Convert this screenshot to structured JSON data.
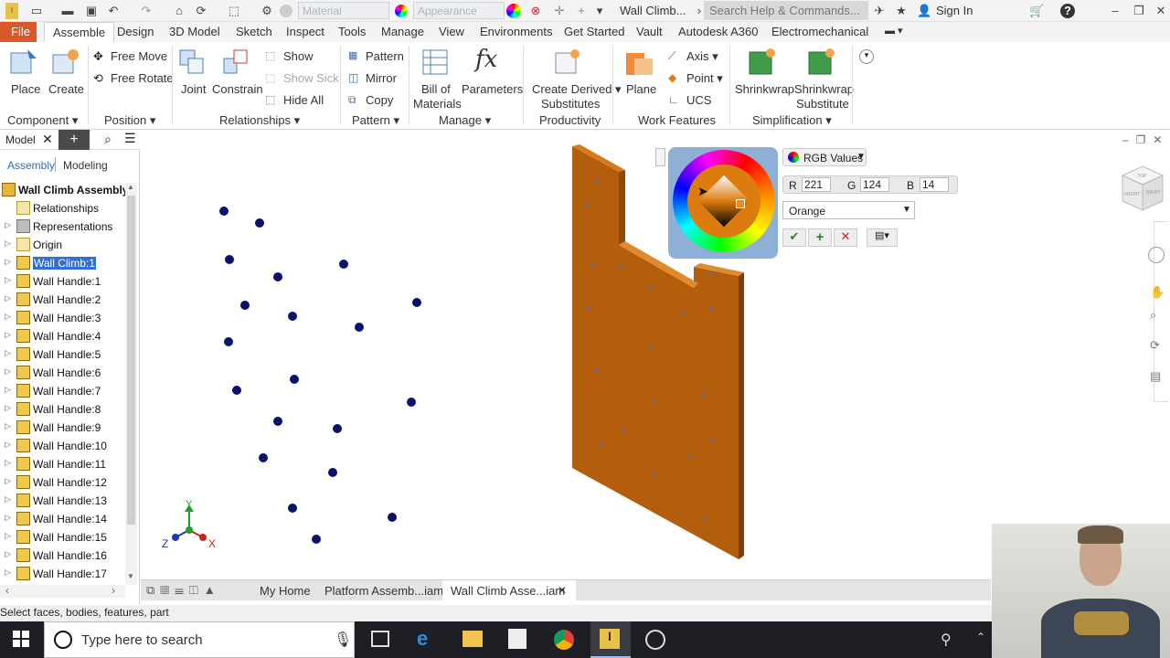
{
  "titlebar": {
    "material_placeholder": "Material",
    "appearance_placeholder": "Appearance",
    "document_title": "Wall Climb...",
    "help_search_placeholder": "Search Help & Commands...",
    "sign_in": "Sign In"
  },
  "tabs": [
    "File",
    "Assemble",
    "Design",
    "3D Model",
    "Sketch",
    "Inspect",
    "Tools",
    "Manage",
    "View",
    "Environments",
    "Get Started",
    "Vault",
    "Autodesk A360",
    "Electromechanical"
  ],
  "ribbon": {
    "place": "Place",
    "create": "Create",
    "free_move": "Free Move",
    "free_rotate": "Free Rotate",
    "joint": "Joint",
    "constrain": "Constrain",
    "show": "Show",
    "show_sick": "Show Sick",
    "hide_all": "Hide All",
    "pattern": "Pattern",
    "mirror": "Mirror",
    "copy": "Copy",
    "bill_of_materials_1": "Bill of",
    "bill_of_materials_2": "Materials",
    "parameters": "Parameters",
    "create_derived_1": "Create Derived",
    "create_derived_2": "Substitutes",
    "plane": "Plane",
    "axis": "Axis",
    "point": "Point",
    "ucs": "UCS",
    "shrinkwrap": "Shrinkwrap",
    "shrinkwrap_sub_1": "Shrinkwrap",
    "shrinkwrap_sub_2": "Substitute",
    "groups": {
      "component": "Component",
      "position": "Position",
      "relationships": "Relationships",
      "pattern": "Pattern",
      "manage": "Manage",
      "productivity": "Productivity",
      "work_features": "Work Features",
      "simplification": "Simplification"
    }
  },
  "browser": {
    "title": "Model",
    "tab_assembly": "Assembly",
    "tab_modeling": "Modeling",
    "root": "Wall Climb Assembly",
    "items": [
      "Relationships",
      "Representations",
      "Origin",
      "Wall Climb:1",
      "Wall Handle:1",
      "Wall Handle:2",
      "Wall Handle:3",
      "Wall Handle:4",
      "Wall Handle:5",
      "Wall Handle:6",
      "Wall Handle:7",
      "Wall Handle:8",
      "Wall Handle:9",
      "Wall Handle:10",
      "Wall Handle:11",
      "Wall Handle:12",
      "Wall Handle:13",
      "Wall Handle:14",
      "Wall Handle:15",
      "Wall Handle:16",
      "Wall Handle:17"
    ]
  },
  "color_picker": {
    "mode": "RGB Values",
    "r_label": "R",
    "r": "221",
    "g_label": "G",
    "g": "124",
    "b_label": "B",
    "b": "14",
    "preset": "Orange",
    "color": "#dd7c0e"
  },
  "triad": {
    "x": "X",
    "y": "Y",
    "z": "Z"
  },
  "viewcube": {
    "top": "TOP",
    "front": "FRONT",
    "right": "RIGHT"
  },
  "doctabs": [
    "My Home",
    "Platform Assemb...iam",
    "Wall Climb Asse...iam"
  ],
  "status": "Select faces, bodies, features, part",
  "taskbar": {
    "search_placeholder": "Type here to search"
  }
}
